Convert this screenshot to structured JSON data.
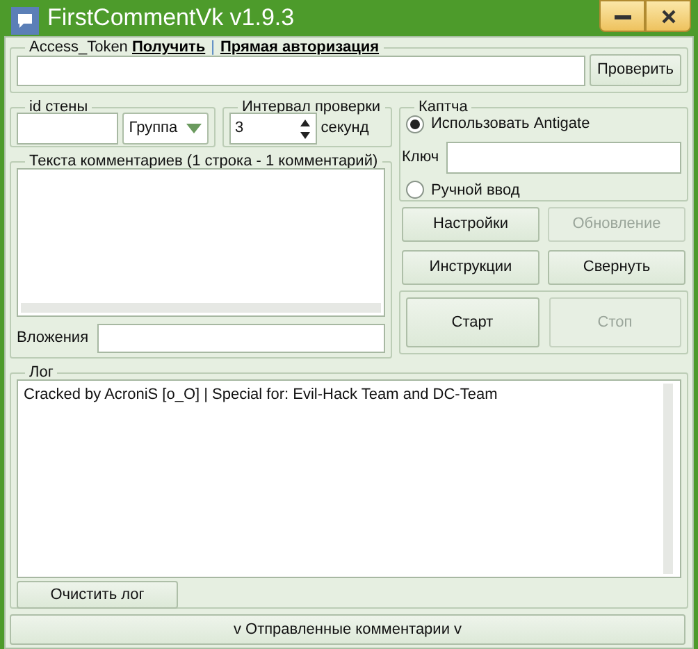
{
  "window": {
    "title": "FirstCommentVk v1.9.3"
  },
  "access_token": {
    "label": "Access_Token",
    "links": [
      "Получить",
      "Прямая авторизация"
    ],
    "separator": "|",
    "button": "Проверить"
  },
  "wall": {
    "label": "id стены",
    "type": "Группа"
  },
  "interval": {
    "label": "Интервал проверки",
    "value": "3",
    "unit": "секунд"
  },
  "captcha": {
    "label": "Каптча",
    "items": [
      {
        "kind": "radio",
        "label": "Использовать Antigate",
        "selected": true
      },
      {
        "kind": "field",
        "label": "Ключ"
      },
      {
        "kind": "radio",
        "label": "Ручной ввод",
        "selected": false
      }
    ]
  },
  "comments": {
    "label": "Текста комментариев (1 строка - 1 комментарий)",
    "attachments_label": "Вложения"
  },
  "buttons": [
    {
      "label": "Настройки",
      "disabled": false
    },
    {
      "label": "Обновление",
      "disabled": true
    },
    {
      "label": "Инструкции",
      "disabled": false
    },
    {
      "label": "Свернуть",
      "disabled": false
    }
  ],
  "controls": [
    {
      "label": "Старт",
      "disabled": false
    },
    {
      "label": "Стоп",
      "disabled": true
    }
  ],
  "log": {
    "label": "Лог",
    "lines": [
      "Cracked by AcroniS [o_O] | Special for: Evil-Hack Team and DC-Team"
    ],
    "clear_button": "Очистить лог"
  },
  "sent_toggle": "v Отправленные комментарии v"
}
